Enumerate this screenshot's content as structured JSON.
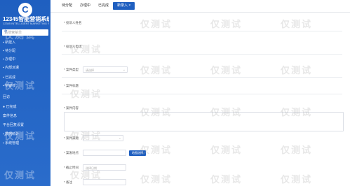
{
  "sidebar": {
    "logo_glyph": "C",
    "brand": "12345智能营销系统",
    "brand_sub": "12345 INTELLIGENT MARKETING SYSTEM",
    "search_placeholder": "请搜索菜单",
    "items": [
      "新建入",
      "待分配",
      "办理中",
      "内部派遣",
      "已完成",
      "待审核",
      "回访",
      "已完成",
      "案件信息",
      "平台回复设置",
      "数据统计",
      "系统管理"
    ]
  },
  "tabs": [
    "待分配",
    "办理中",
    "已完成",
    "新录入 ×"
  ],
  "form": {
    "caller_name": "* 投诉人姓名",
    "caller_phone": "* 投诉人电话",
    "case_type": "* 案件类型",
    "case_type_placeholder": "请选择",
    "case_title": "* 案件标题",
    "case_content": "* 案件内容",
    "source": "* 案件来源",
    "address": "* 案发地点",
    "address_btn": "地图选择",
    "deadline": "* 截止时间",
    "deadline_placeholder": "选择日期",
    "more": "* 备注"
  },
  "watermark": "仅测试"
}
